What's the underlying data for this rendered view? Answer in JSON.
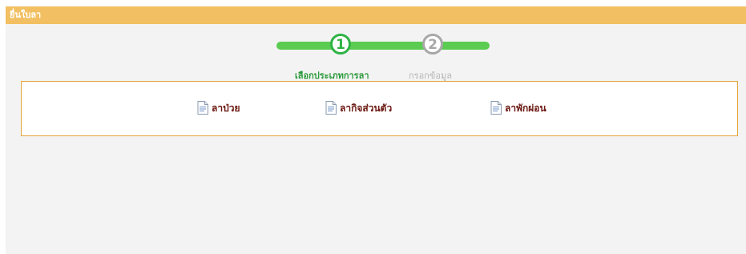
{
  "header": {
    "title": "ยื่นใบลา"
  },
  "stepper": {
    "current_step": 1,
    "steps": [
      {
        "number": "1",
        "label": "เลือกประเภทการลา",
        "state": "active"
      },
      {
        "number": "2",
        "label": "กรอกข้อมูล",
        "state": "inactive"
      }
    ]
  },
  "leave_types": {
    "items": [
      {
        "label": "ลาป่วย",
        "icon": "document-icon"
      },
      {
        "label": "ลากิจส่วนตัว",
        "icon": "document-icon"
      },
      {
        "label": "ลาพักผ่อน",
        "icon": "document-icon"
      }
    ]
  },
  "colors": {
    "header_bg": "#f2c062",
    "panel_bg": "#f3f3f3",
    "step_active": "#2eb344",
    "step_inactive": "#a7a7a7",
    "progress_bar": "#5bcc52",
    "options_border": "#e5a43c",
    "option_text": "#6b1710"
  }
}
